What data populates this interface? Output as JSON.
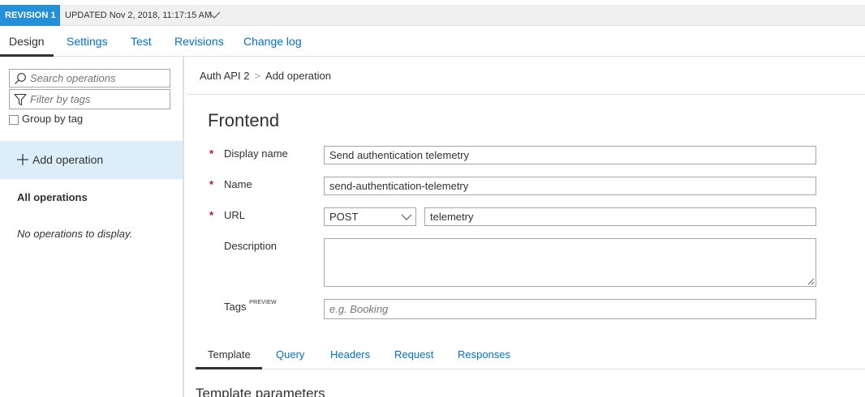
{
  "revision_bar": {
    "badge": "REVISION 1",
    "updated": "UPDATED Nov 2, 2018, 11:17:15 AM",
    "chevron_icon": "chevron-down-icon"
  },
  "top_tabs": [
    {
      "label": "Design",
      "active": true
    },
    {
      "label": "Settings",
      "active": false
    },
    {
      "label": "Test",
      "active": false
    },
    {
      "label": "Revisions",
      "active": false
    },
    {
      "label": "Change log",
      "active": false
    }
  ],
  "sidebar": {
    "search_placeholder": "Search operations",
    "filter_placeholder": "Filter by tags",
    "group_by_tag_label": "Group by tag",
    "group_by_tag_checked": false,
    "add_operation_label": "Add operation",
    "all_operations_heading": "All operations",
    "empty_message": "No operations to display."
  },
  "breadcrumb": {
    "api": "Auth API 2",
    "separator": ">",
    "current": "Add operation"
  },
  "frontend": {
    "title": "Frontend",
    "required_marker": "*",
    "display_name": {
      "label": "Display name",
      "value": "Send authentication telemetry"
    },
    "name": {
      "label": "Name",
      "value": "send-authentication-telemetry"
    },
    "url": {
      "label": "URL",
      "method": "POST",
      "value": "telemetry"
    },
    "description": {
      "label": "Description",
      "value": ""
    },
    "tags": {
      "label": "Tags",
      "badge": "PREVIEW",
      "placeholder": "e.g. Booking"
    }
  },
  "detail_tabs": [
    {
      "label": "Template",
      "active": true
    },
    {
      "label": "Query",
      "active": false
    },
    {
      "label": "Headers",
      "active": false
    },
    {
      "label": "Request",
      "active": false
    },
    {
      "label": "Responses",
      "active": false
    }
  ],
  "template_parameters_heading": "Template parameters",
  "colors": {
    "accent": "#2590d8",
    "link": "#0072c6",
    "selected_bg": "#ddeefb",
    "required": "#c50f1f"
  }
}
